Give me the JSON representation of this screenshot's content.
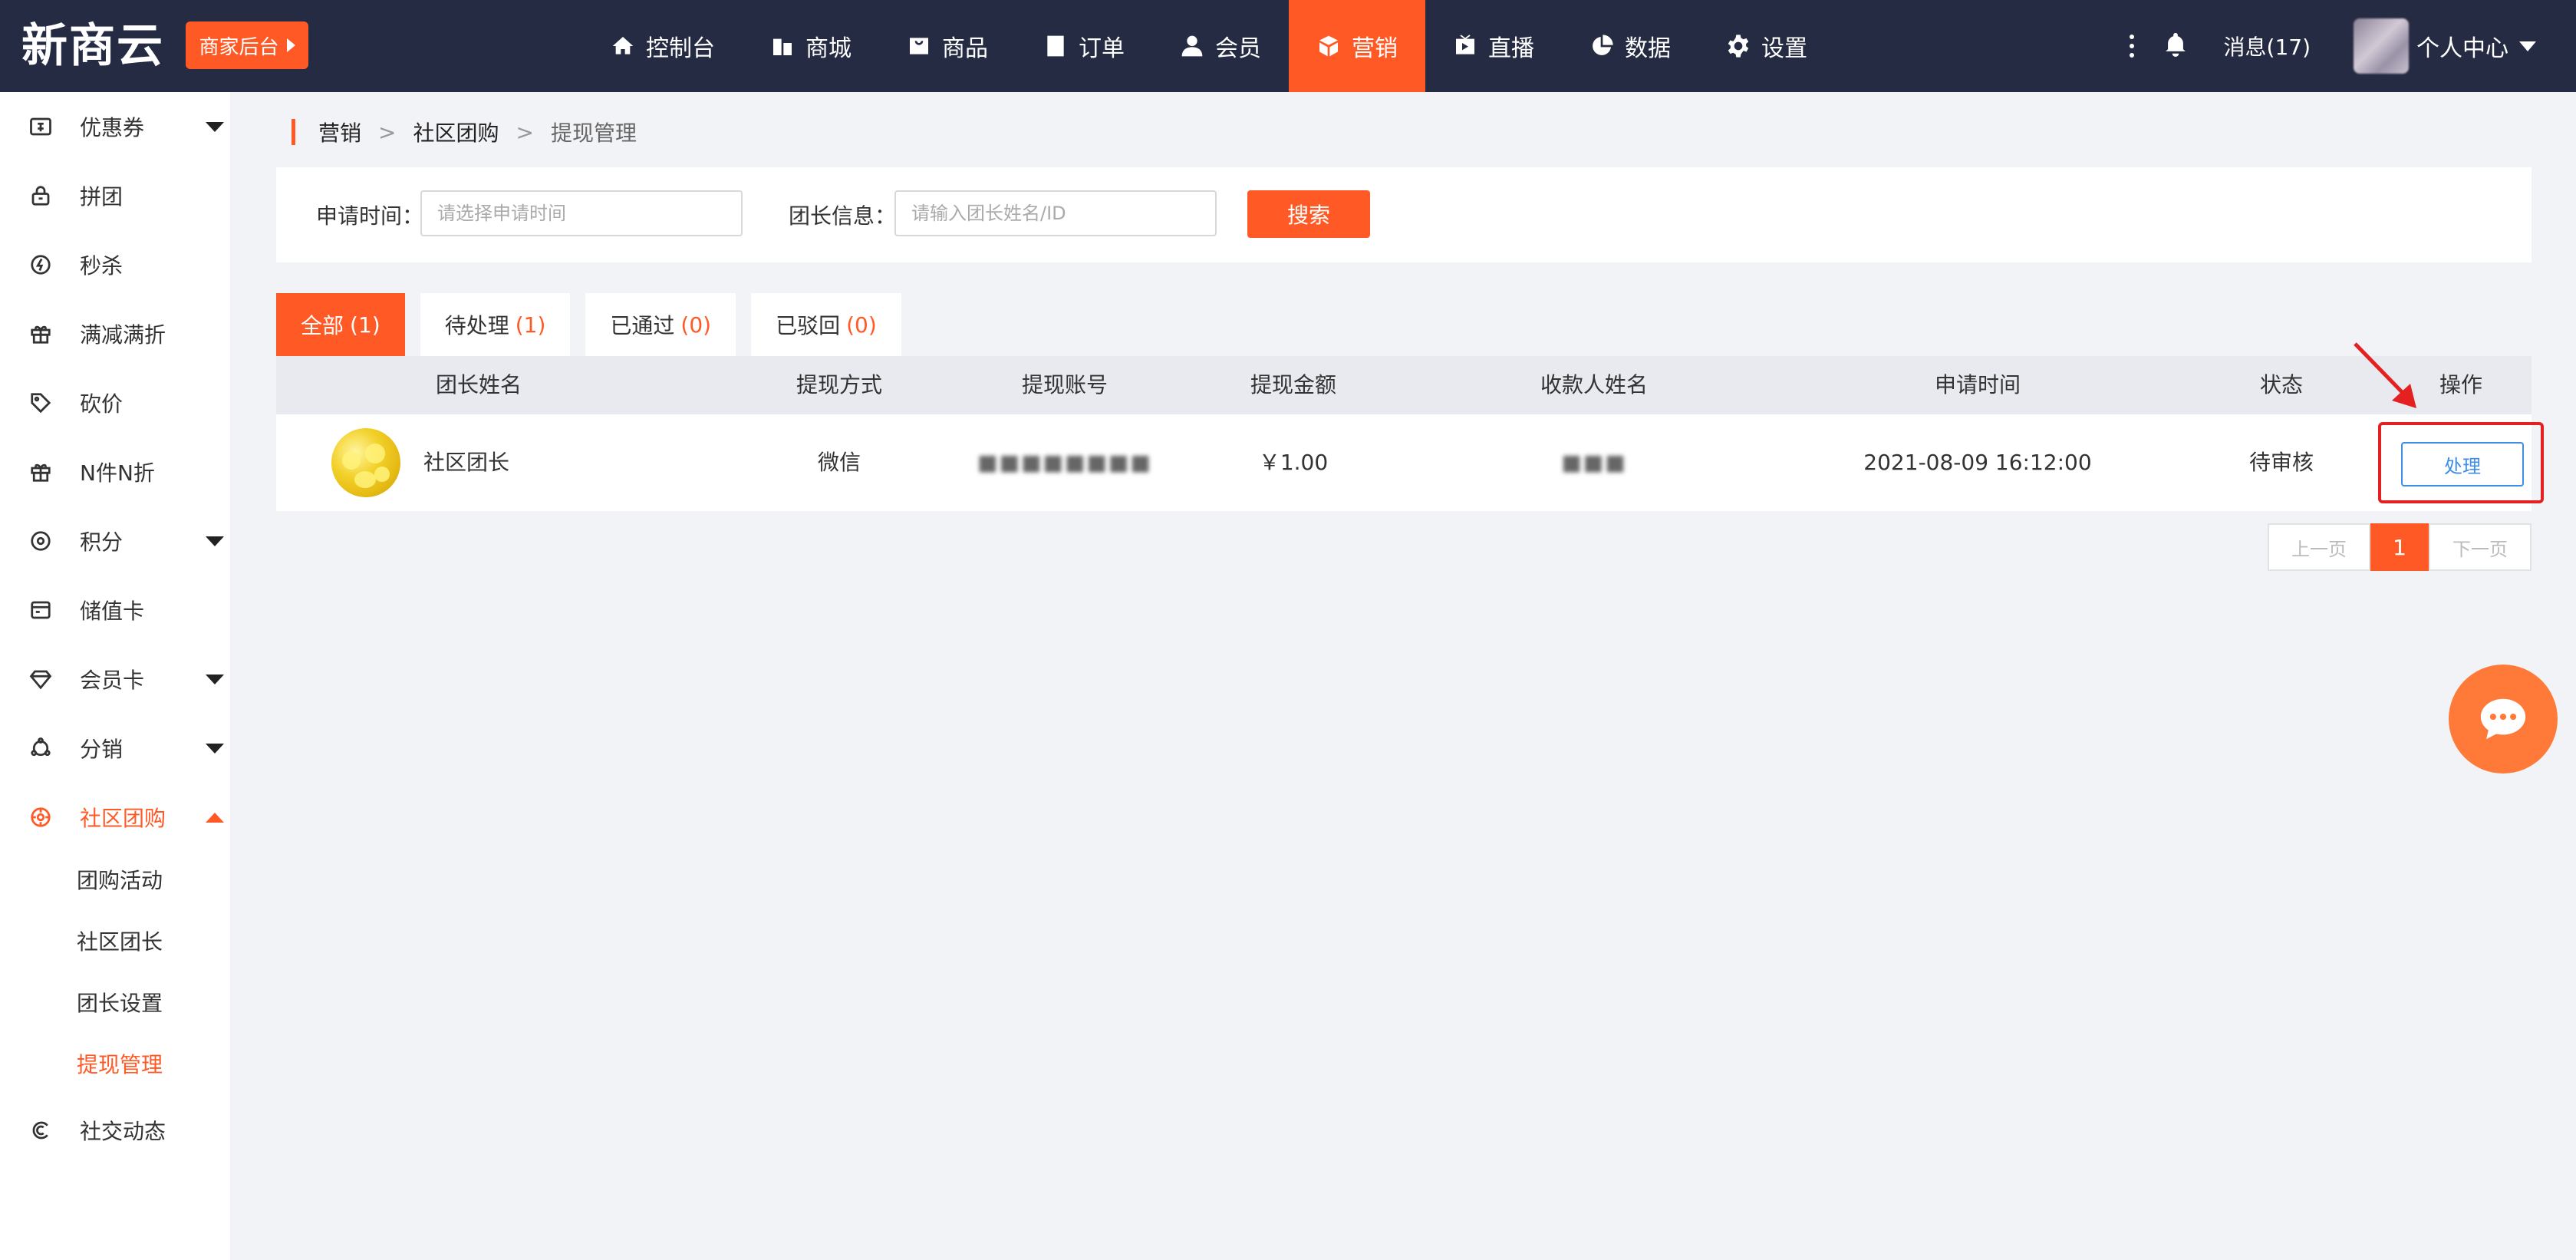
{
  "header": {
    "logo": "新商云",
    "merchant_button": "商家后台",
    "nav": [
      {
        "label": "控制台",
        "icon": "home-icon"
      },
      {
        "label": "商城",
        "icon": "building-icon"
      },
      {
        "label": "商品",
        "icon": "bag-icon"
      },
      {
        "label": "订单",
        "icon": "document-icon"
      },
      {
        "label": "会员",
        "icon": "user-icon"
      },
      {
        "label": "营销",
        "icon": "cube-icon",
        "active": true
      },
      {
        "label": "直播",
        "icon": "tv-icon"
      },
      {
        "label": "数据",
        "icon": "pie-chart-icon"
      },
      {
        "label": "设置",
        "icon": "gear-icon"
      }
    ],
    "messages": "消息(17)",
    "personal_center": "个人中心"
  },
  "sidebar": {
    "items": [
      {
        "label": "优惠券",
        "icon": "coupon-icon",
        "expandable": true
      },
      {
        "label": "拼团",
        "icon": "lock-bag-icon"
      },
      {
        "label": "秒杀",
        "icon": "lightning-circle-icon"
      },
      {
        "label": "满减满折",
        "icon": "gift-icon"
      },
      {
        "label": "砍价",
        "icon": "tag-icon"
      },
      {
        "label": "N件N折",
        "icon": "gift-icon"
      },
      {
        "label": "积分",
        "icon": "points-icon",
        "expandable": true
      },
      {
        "label": "储值卡",
        "icon": "card-icon"
      },
      {
        "label": "会员卡",
        "icon": "diamond-icon",
        "expandable": true
      },
      {
        "label": "分销",
        "icon": "distribution-icon",
        "expandable": true
      },
      {
        "label": "社区团购",
        "icon": "community-icon",
        "expandable": true,
        "active": true
      },
      {
        "label": "社交动态",
        "icon": "social-icon"
      }
    ],
    "sub_items": [
      "团购活动",
      "社区团长",
      "团长设置",
      "提现管理"
    ],
    "active_sub": "提现管理"
  },
  "breadcrumb": [
    "营销",
    "社区团购",
    "提现管理"
  ],
  "filter": {
    "time_label": "申请时间：",
    "time_placeholder": "请选择申请时间",
    "leader_label": "团长信息：",
    "leader_placeholder": "请输入团长姓名/ID",
    "search_button": "搜索"
  },
  "tabs": [
    {
      "label": "全部",
      "count": "(1)",
      "active": true
    },
    {
      "label": "待处理",
      "count": "(1)"
    },
    {
      "label": "已通过",
      "count": "(0)"
    },
    {
      "label": "已驳回",
      "count": "(0)"
    }
  ],
  "table": {
    "columns": [
      "团长姓名",
      "提现方式",
      "提现账号",
      "提现金额",
      "收款人姓名",
      "申请时间",
      "状态",
      "操作"
    ],
    "rows": [
      {
        "leader_name": "社区团长",
        "method": "微信",
        "account": "■■■■■■■■",
        "amount": "￥1.00",
        "payee": "■■■",
        "time": "2021-08-09 16:12:00",
        "status": "待审核",
        "action": "处理"
      }
    ]
  },
  "pagination": {
    "prev": "上一页",
    "current": "1",
    "next": "下一页"
  },
  "colors": {
    "accent": "#ff5a26",
    "topbar": "#252b43",
    "link": "#3e8ee6",
    "annotation": "#e42020"
  }
}
